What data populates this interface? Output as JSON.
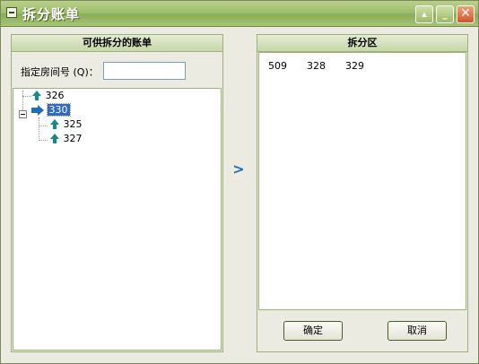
{
  "window": {
    "title": "拆分账单"
  },
  "left_panel": {
    "header": "可供拆分的账单",
    "room_label": "指定房间号",
    "room_label_mnemonic": "(Q)",
    "room_label_colon": "：",
    "room_input_value": "",
    "tree": [
      {
        "label": "326"
      },
      {
        "label": "330",
        "selected": true,
        "children": [
          {
            "label": "325"
          },
          {
            "label": "327"
          }
        ]
      }
    ]
  },
  "move_button": {
    "label": ">"
  },
  "right_panel": {
    "header": "拆分区",
    "items": [
      "509",
      "328",
      "329"
    ],
    "ok_label": "确定",
    "cancel_label": "取消"
  },
  "colors": {
    "title_bar": "#9fbf6c",
    "selection": "#316ac5",
    "arrow": "#138a8c"
  }
}
